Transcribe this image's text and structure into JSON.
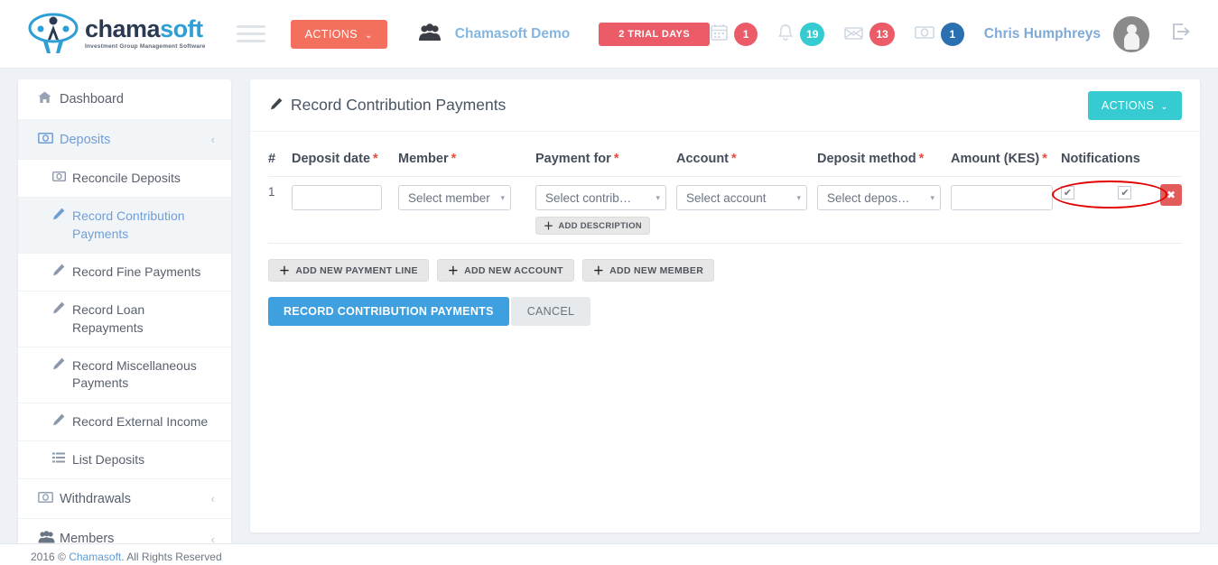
{
  "brand": {
    "word_primary": "chama",
    "word_secondary": "soft",
    "tagline": "Investment Group Management Software"
  },
  "topbar": {
    "actions_label": "ACTIONS",
    "actions_caret": "⌄",
    "group_name": "Chamasoft Demo",
    "trial_badge": "2 TRIAL DAYS",
    "user_name": "Chris Humphreys",
    "notifications": [
      {
        "icon": "calendar-icon",
        "glyph": "🗓",
        "count": "1",
        "color": "red"
      },
      {
        "icon": "bell-icon",
        "glyph": "🔔",
        "count": "19",
        "color": "teal"
      },
      {
        "icon": "envelope-icon",
        "glyph": "✉",
        "count": "13",
        "color": "red"
      },
      {
        "icon": "money-icon",
        "glyph": "💵",
        "count": "1",
        "color": "blue"
      }
    ]
  },
  "sidebar": {
    "items": [
      {
        "label": "Dashboard",
        "icon": "home-icon",
        "glyph": "🏠",
        "active": false,
        "chevron": ""
      },
      {
        "label": "Deposits",
        "icon": "money-icon",
        "glyph": "💵",
        "active": true,
        "chevron": "‹"
      }
    ],
    "sub_items": [
      {
        "label": "Reconcile Deposits",
        "icon": "money-icon",
        "glyph": "💵",
        "active": false
      },
      {
        "label": "Record Contribution Payments",
        "icon": "pencil-icon",
        "glyph": "✎",
        "active": true
      },
      {
        "label": "Record Fine Payments",
        "icon": "pencil-icon",
        "glyph": "✎",
        "active": false
      },
      {
        "label": "Record Loan Repayments",
        "icon": "pencil-icon",
        "glyph": "✎",
        "active": false
      },
      {
        "label": "Record Miscellaneous Payments",
        "icon": "pencil-icon",
        "glyph": "✎",
        "active": false
      },
      {
        "label": "Record External Income",
        "icon": "pencil-icon",
        "glyph": "✎",
        "active": false
      },
      {
        "label": "List Deposits",
        "icon": "list-icon",
        "glyph": "☰",
        "active": false
      }
    ],
    "items_bottom": [
      {
        "label": "Withdrawals",
        "icon": "money-icon",
        "glyph": "💵",
        "chevron": "‹"
      },
      {
        "label": "Members",
        "icon": "people-icon",
        "glyph": "👥",
        "chevron": "‹"
      }
    ]
  },
  "panel": {
    "title": "Record Contribution Payments",
    "title_icon": "pencil-icon",
    "actions_label": "ACTIONS",
    "actions_caret": "⌄"
  },
  "table": {
    "headers": [
      {
        "label": "#",
        "required": false
      },
      {
        "label": "Deposit date",
        "required": true
      },
      {
        "label": "Member",
        "required": true
      },
      {
        "label": "Payment for",
        "required": true
      },
      {
        "label": "Account",
        "required": true
      },
      {
        "label": "Deposit method",
        "required": true
      },
      {
        "label": "Amount (KES)",
        "required": true
      },
      {
        "label": "Notifications",
        "required": false
      }
    ],
    "required_marker": "*",
    "row": {
      "index": "1",
      "deposit_date_value": "",
      "deposit_date_placeholder": "",
      "member_value": "Select member",
      "payment_for_value": "Select contrib…",
      "account_value": "Select account",
      "deposit_method_value": "Select depos…",
      "amount_value": "",
      "amount_placeholder": "",
      "add_description_label": "ADD DESCRIPTION",
      "notification_checkbox_1_checked": true,
      "notification_checkbox_2_checked": true,
      "delete_label": "✖",
      "caret_glyph": "▾",
      "check_glyph": "✔",
      "plus_glyph": "＋"
    }
  },
  "buttons": {
    "add_payment_line": "ADD NEW PAYMENT LINE",
    "add_account": "ADD NEW ACCOUNT",
    "add_member": "ADD NEW MEMBER",
    "submit": "RECORD CONTRIBUTION PAYMENTS",
    "cancel": "CANCEL"
  },
  "footer": {
    "text_before": "2016 © ",
    "link": "Chamasoft",
    "text_after": ". All Rights Reserved"
  }
}
